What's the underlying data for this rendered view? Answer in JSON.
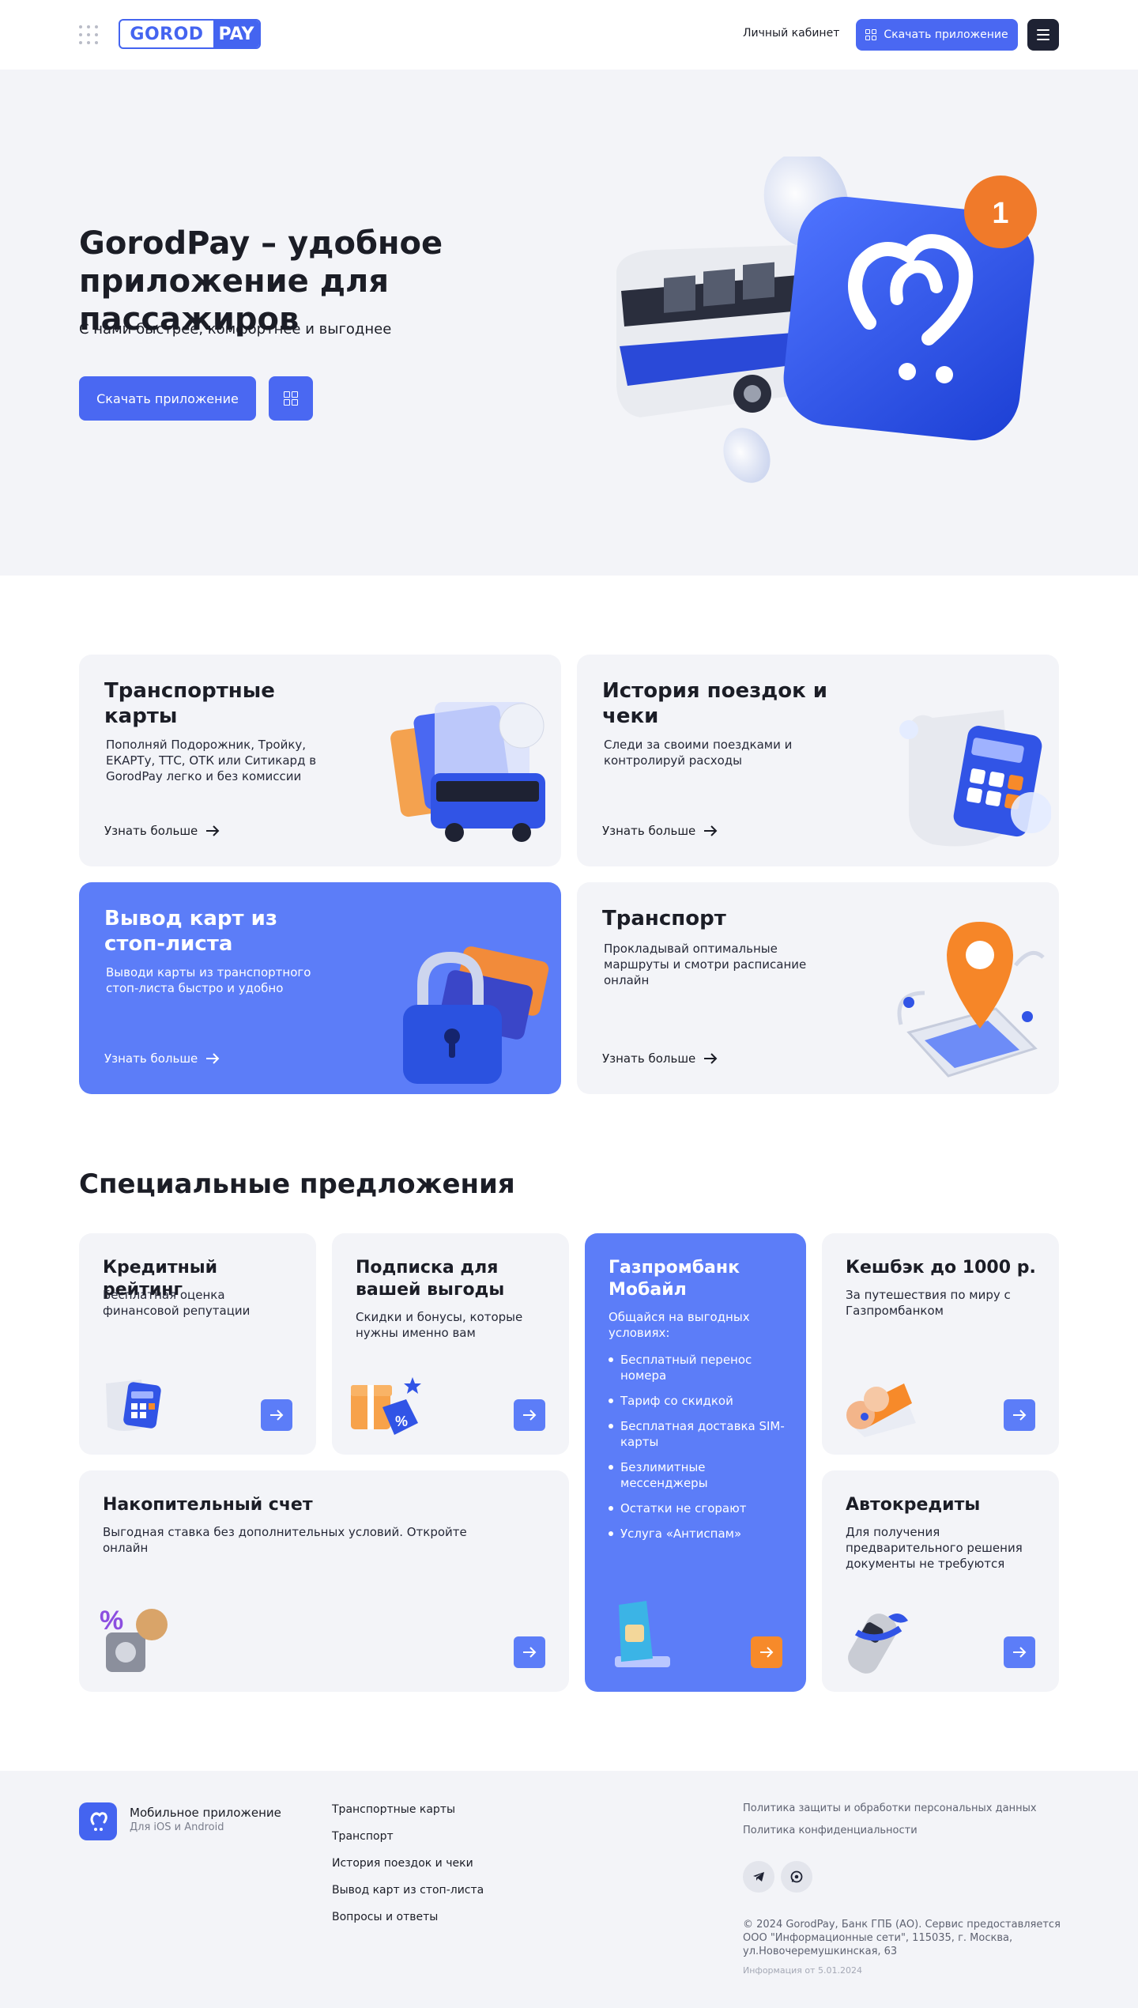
{
  "header": {
    "logo_left": "GOROD",
    "logo_right": "PAY",
    "cabinet_label": "Личный кабинет",
    "download_label": "Скачать приложение"
  },
  "hero": {
    "title": "GorodPay – удобное приложение для пассажиров",
    "subtitle": "С нами быстрее, комфортнее и выгоднее",
    "download_label": "Скачать приложение",
    "badge_count": "1"
  },
  "features": [
    {
      "title": "Транспортные карты",
      "text": "Пополняй Подорожник, Тройку, ЕКАРТу, ТТС, ОТК или Ситикард в GorodPay легко и без комиссии",
      "more": "Узнать больше"
    },
    {
      "title": "История поездок и чеки",
      "text": "Следи за своими поездками и контролируй расходы",
      "more": "Узнать больше"
    },
    {
      "title": "Вывод карт из стоп-листа",
      "text": "Выводи карты из транспортного стоп-листа быстро и удобно",
      "more": "Узнать больше"
    },
    {
      "title": "Транспорт",
      "text": "Прокладывай оптимальные маршруты и смотри расписание онлайн",
      "more": "Узнать больше"
    }
  ],
  "offers_title": "Специальные предложения",
  "offers": [
    {
      "title": "Кредитный рейтинг",
      "text": "Бесплатная оценка финансовой репутации"
    },
    {
      "title": "Подписка для вашей выгоды",
      "text": "Скидки и бонусы, которые нужны именно вам"
    },
    {
      "title": "Газпромбанк Мобайл",
      "text": "Общайся на выгодных условиях:",
      "items": [
        "Бесплатный перенос номера",
        "Тариф со скидкой",
        "Бесплатная доставка SIM-карты",
        "Безлимитные мессенджеры",
        "Остатки не сгорают",
        "Услуга «Антиспам»"
      ]
    },
    {
      "title": "Кешбэк до 1000 р.",
      "text": "За путешествия по миру с Газпромбанком"
    },
    {
      "title": "Накопительный счет",
      "text": "Выгодная ставка без дополнительных условий. Откройте онлайн"
    },
    {
      "title": "Автокредиты",
      "text": "Для получения предварительного решения документы не требуются"
    }
  ],
  "footer": {
    "app_title": "Мобильное приложение",
    "app_sub": "Для iOS и Android",
    "nav": [
      "Транспортные карты",
      "Транспорт",
      "История поездок и чеки",
      "Вывод карт из стоп-листа",
      "Вопросы и ответы"
    ],
    "legal": [
      "Политика защиты и обработки персональных данных",
      "Политика конфиденциальности"
    ],
    "copyright": "© 2024 GorodPay, Банк ГПБ (АО). Сервис предоставляется ООО \"Информационные сети\", 115035, г. Москва, ул.Новочеремушкинская, 63",
    "info_date": "Информация от 5.01.2024"
  },
  "colors": {
    "accent": "#4a68f2",
    "card_blue": "#5c7df8",
    "orange": "#f78a2a",
    "bg_light": "#f3f4f8",
    "dark": "#1e2233"
  }
}
